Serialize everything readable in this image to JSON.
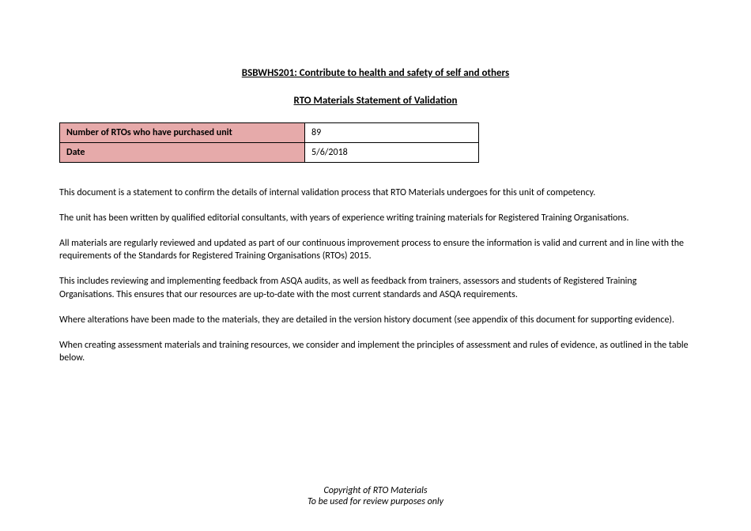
{
  "title": "BSBWHS201: Contribute to health and safety of self and others",
  "subtitle": "RTO Materials Statement of Validation",
  "table": {
    "row1": {
      "label": "Number of RTOs who have purchased unit",
      "value": "89"
    },
    "row2": {
      "label": "Date",
      "value": "5/6/2018"
    }
  },
  "paragraphs": {
    "p1": "This document is a statement to confirm the details of internal validation process that RTO Materials undergoes for this unit of competency.",
    "p2": "The unit has been written by qualified editorial consultants, with years of experience writing training materials for Registered Training Organisations.",
    "p3": "All materials are regularly reviewed and updated as part of our continuous improvement process to ensure the information is valid and current and in line with the requirements of the Standards for Registered Training Organisations (RTOs) 2015.",
    "p4": "This includes reviewing and implementing feedback from ASQA audits, as well as feedback from trainers, assessors and students of Registered Training Organisations. This ensures that our resources are up-to-date with the most current standards and ASQA requirements.",
    "p5": "Where alterations have been made to the materials, they are detailed in the version history document (see appendix of this document for supporting evidence).",
    "p6": "When creating assessment materials and training resources, we consider and implement the principles of assessment and rules of evidence, as outlined in the table below."
  },
  "footer": {
    "line1": "Copyright of RTO Materials",
    "line2": "To be used for review purposes only"
  }
}
